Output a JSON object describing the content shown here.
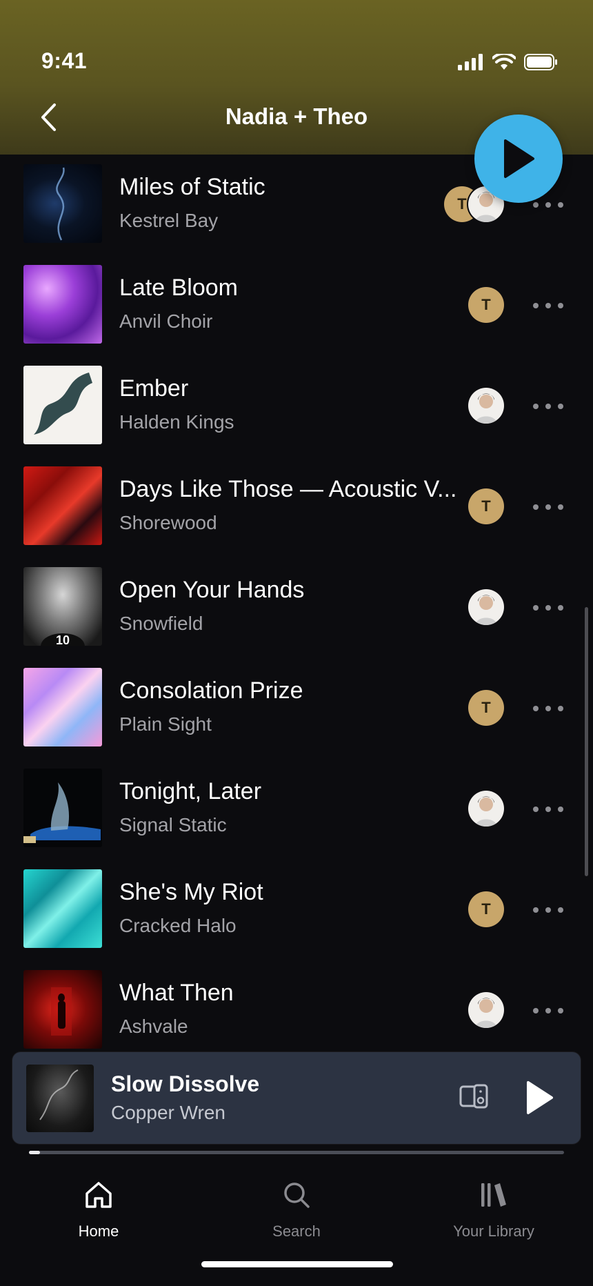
{
  "status_bar": {
    "time": "9:41"
  },
  "header": {
    "title": "Nadia + Theo"
  },
  "tracks": [
    {
      "title": "Miles of Static",
      "artist": "Kestrel Bay",
      "added_by": [
        "T",
        "N"
      ]
    },
    {
      "title": "Late Bloom",
      "artist": "Anvil Choir",
      "added_by": [
        "T"
      ]
    },
    {
      "title": "Ember",
      "artist": "Halden Kings",
      "added_by": [
        "N"
      ]
    },
    {
      "title": "Days Like Those — Acoustic V...",
      "artist": "Shorewood",
      "added_by": [
        "T"
      ]
    },
    {
      "title": "Open Your Hands",
      "artist": "Snowfield",
      "added_by": [
        "N"
      ]
    },
    {
      "title": "Consolation Prize",
      "artist": "Plain Sight",
      "added_by": [
        "T"
      ]
    },
    {
      "title": "Tonight, Later",
      "artist": "Signal Static",
      "added_by": [
        "N"
      ]
    },
    {
      "title": "She's My Riot",
      "artist": "Cracked Halo",
      "added_by": [
        "T"
      ]
    },
    {
      "title": "What Then",
      "artist": "Ashvale",
      "added_by": [
        "N"
      ]
    }
  ],
  "avatar_t_label": "T",
  "mini_player": {
    "title": "Slow Dissolve",
    "artist": "Copper Wren",
    "progress": 0.02
  },
  "nav": [
    {
      "label": "Home",
      "icon": "home-icon",
      "active": true
    },
    {
      "label": "Search",
      "icon": "search-icon",
      "active": false
    },
    {
      "label": "Your Library",
      "icon": "library-icon",
      "active": false
    }
  ],
  "colors": {
    "accent": "#3fb3e8",
    "header": "#6a6323",
    "avatar_t": "#c8a66a",
    "background": "#0c0c0f",
    "mini_player": "#2c3342"
  }
}
